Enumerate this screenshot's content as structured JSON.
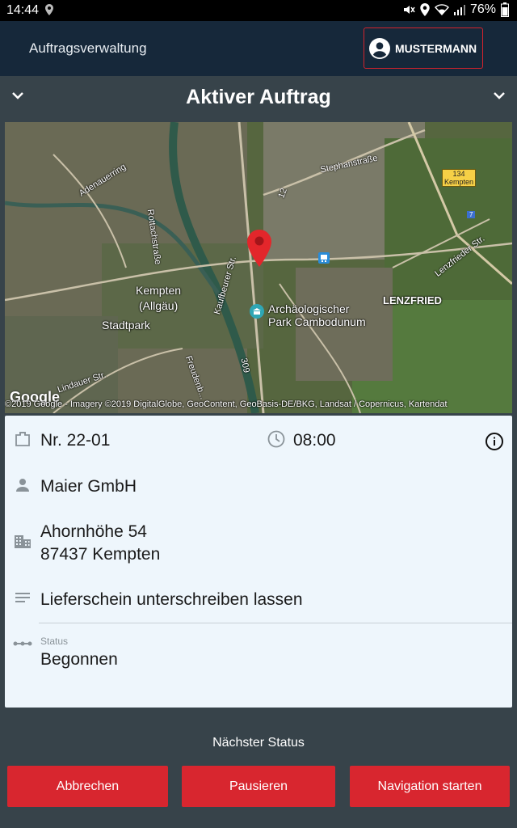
{
  "status_bar": {
    "time": "14:44",
    "battery": "76%"
  },
  "app_bar": {
    "title": "Auftragsverwaltung",
    "user_label": "MUSTERMANN"
  },
  "section": {
    "title": "Aktiver Auftrag"
  },
  "map": {
    "labels": {
      "adenauerring": "Adenauerring",
      "rottachstrasse": "Rottachstraße",
      "stephanstrasse": "Stephanstraße",
      "kempten_allgaeu_1": "Kempten",
      "kempten_allgaeu_2": "(Allgäu)",
      "stadtpark": "Stadtpark",
      "kaufbeurer": "Kaufbeurer Str.",
      "poi_1": "Archäologischer",
      "poi_2": "Park Cambodunum",
      "lenzfried": "LENZFRIED",
      "lenzfrieder": "Lenzfrieder Str.",
      "lindauer": "Lindauer Str.",
      "freudenb": "Freudenb...",
      "road_309": "309",
      "road_12": "12",
      "shield_134": "134",
      "shield_kempten": "Kempten",
      "shield_7": "7"
    },
    "google": "Google",
    "copyright": "©2019 Google - Imagery ©2019 DigitalGlobe, GeoContent, GeoBasis-DE/BKG, Landsat / Copernicus, Kartendat"
  },
  "order": {
    "number": "Nr. 22-01",
    "time": "08:00",
    "customer": "Maier GmbH",
    "street": "Ahornhöhe 54",
    "city": "87437 Kempten",
    "note": "Lieferschein unterschreiben lassen",
    "status_label": "Status",
    "status_value": "Begonnen"
  },
  "actions": {
    "next_status_label": "Nächster Status",
    "cancel": "Abbrechen",
    "pause": "Pausieren",
    "navigate": "Navigation starten"
  },
  "colors": {
    "header_bg": "#16283a",
    "section_bg": "#37434a",
    "accent_red": "#d8262f",
    "card_bg": "#eef6fc"
  }
}
